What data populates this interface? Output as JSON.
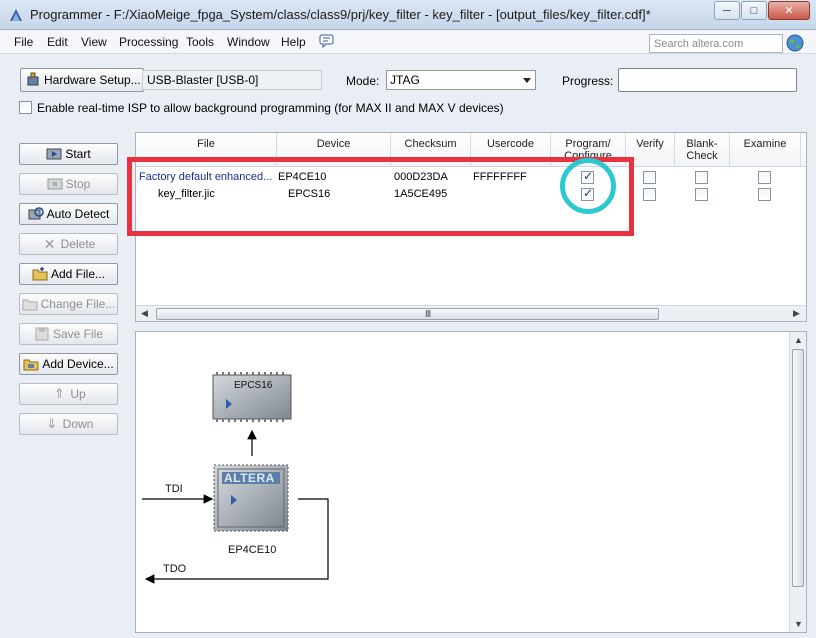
{
  "window": {
    "title": "Programmer - F:/XiaoMeige_fpga_System/class/class9/prj/key_filter - key_filter - [output_files/key_filter.cdf]*",
    "buttons": {
      "minimize": "─",
      "maximize": "□",
      "close": "✕"
    }
  },
  "menu": {
    "items": [
      "File",
      "Edit",
      "View",
      "Processing",
      "Tools",
      "Window",
      "Help"
    ],
    "search_placeholder": "Search altera.com"
  },
  "hardware": {
    "setup_label": "Hardware Setup...",
    "device_value": "USB-Blaster [USB-0]",
    "mode_label": "Mode:",
    "mode_value": "JTAG",
    "progress_label": "Progress:",
    "progress_value": 0,
    "isp_label": "Enable real-time ISP to allow background programming (for MAX II and MAX V devices)",
    "isp_checked": false
  },
  "left_buttons": [
    {
      "label": "Start",
      "enabled": true
    },
    {
      "label": "Stop",
      "enabled": false
    },
    {
      "label": "Auto Detect",
      "enabled": true
    },
    {
      "label": "Delete",
      "enabled": false
    },
    {
      "label": "Add File...",
      "enabled": true
    },
    {
      "label": "Change File...",
      "enabled": false
    },
    {
      "label": "Save File",
      "enabled": false
    },
    {
      "label": "Add Device...",
      "enabled": true
    },
    {
      "label": "Up",
      "enabled": false
    },
    {
      "label": "Down",
      "enabled": false
    }
  ],
  "table": {
    "columns": [
      "File",
      "Device",
      "Checksum",
      "Usercode",
      "Program/\nConfigure",
      "Verify",
      "Blank-\nCheck",
      "Examine"
    ],
    "rows": [
      {
        "file": "Factory default enhanced...",
        "device": "EP4CE10",
        "checksum": "000D23DA",
        "usercode": "FFFFFFFF",
        "program": true,
        "verify": false,
        "blank": false,
        "examine": false
      },
      {
        "file": "key_filter.jic",
        "device": "EPCS16",
        "checksum": "1A5CE495",
        "usercode": "",
        "program": true,
        "verify": false,
        "blank": false,
        "examine": false
      }
    ],
    "scroll_grip": "III"
  },
  "diagram": {
    "flash_label": "EPCS16",
    "fpga_label": "EP4CE10",
    "fpga_logo": "ALTERA",
    "tdi_label": "TDI",
    "tdo_label": "TDO"
  },
  "colors": {
    "highlight_box": "#e8323f",
    "highlight_circle": "#2cc8d0",
    "link_text": "#1b2f8a"
  }
}
